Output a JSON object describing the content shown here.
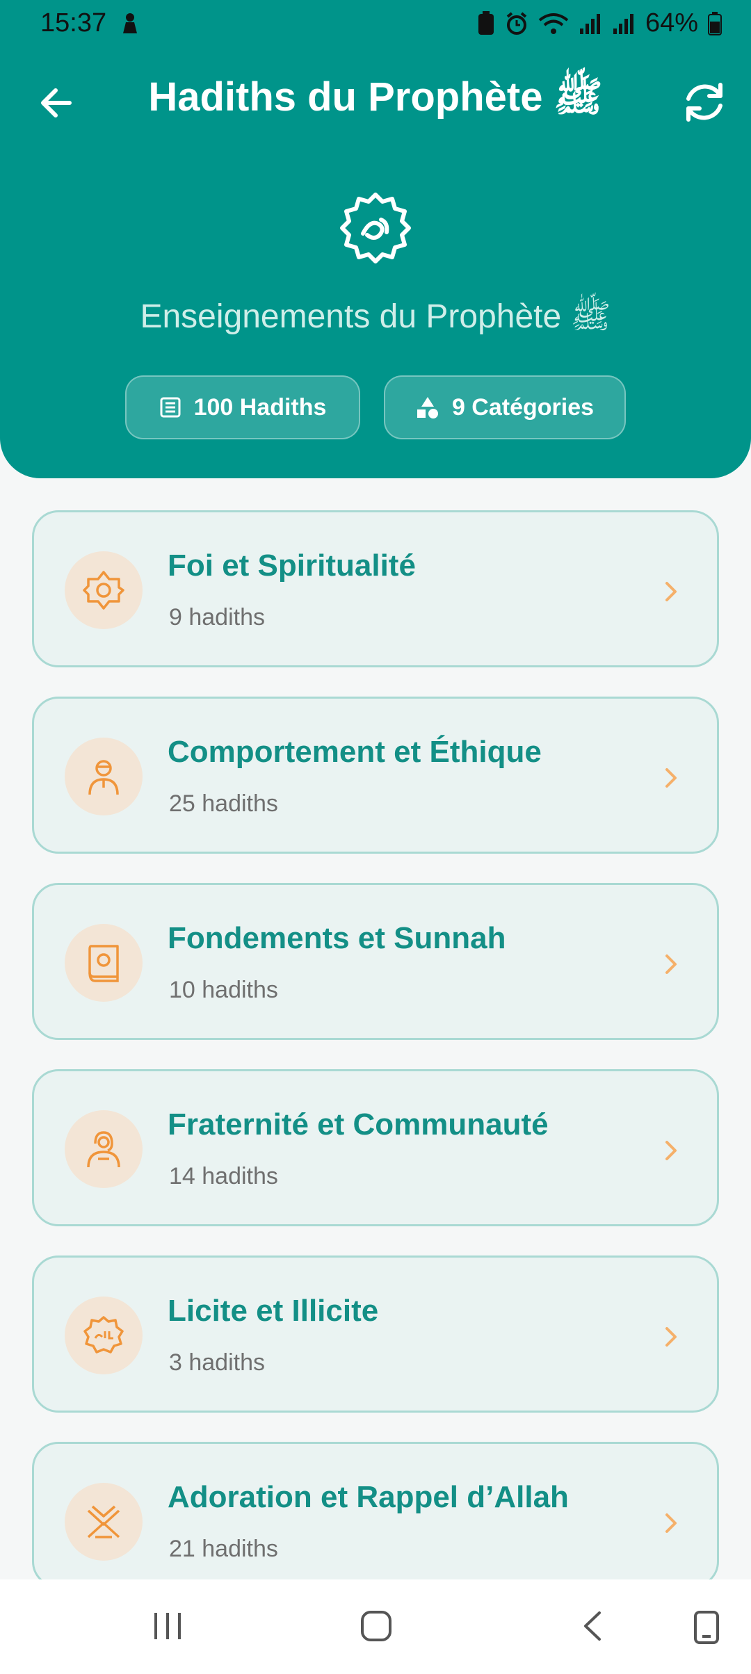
{
  "status_bar": {
    "time": "15:37",
    "battery": "64%"
  },
  "header": {
    "title": "Hadiths du Prophète ﷺ",
    "subtitle": "Enseignements du Prophète ﷺ",
    "stats": [
      {
        "icon": "list-icon",
        "label": "100 Hadiths"
      },
      {
        "icon": "shapes-icon",
        "label": "9 Catégories"
      }
    ]
  },
  "colors": {
    "primary": "#00948a",
    "title_teal": "#138f86",
    "accent_orange": "#f0953a",
    "card_bg": "#eaf3f2",
    "card_border": "#a9d9d3"
  },
  "categories": [
    {
      "title": "Foi et Spiritualité",
      "count": "9 hadiths",
      "icon": "spirituality-icon"
    },
    {
      "title": "Comportement et Éthique",
      "count": "25 hadiths",
      "icon": "person-icon"
    },
    {
      "title": "Fondements et Sunnah",
      "count": "10 hadiths",
      "icon": "book-icon"
    },
    {
      "title": "Fraternité et Communauté",
      "count": "14 hadiths",
      "icon": "community-icon"
    },
    {
      "title": "Licite et Illicite",
      "count": "3 hadiths",
      "icon": "halal-icon"
    },
    {
      "title": "Adoration et Rappel d’Allah",
      "count": "21 hadiths",
      "icon": "quran-stand-icon"
    }
  ]
}
